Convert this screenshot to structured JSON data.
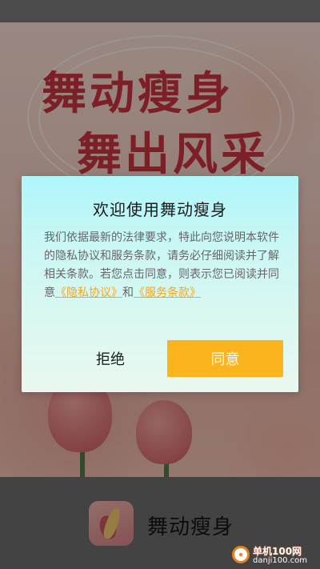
{
  "splash": {
    "slogan_line1": "舞动瘦身",
    "slogan_line2": "舞出风采"
  },
  "dialog": {
    "title": "欢迎使用舞动瘦身",
    "body_text": "我们依据最新的法律要求，特此向您说明本软件的隐私协议和服务条款，请务必仔细阅读并了解相关条款。若您点击同意，则表示您已阅读并同意",
    "privacy_link": "《隐私协议》",
    "conjunction": "和",
    "terms_link": "《服务条款》",
    "refuse_label": "拒绝",
    "agree_label": "同意"
  },
  "app": {
    "name": "舞动瘦身",
    "icon": "dancer-app-icon"
  },
  "watermark": {
    "name": "单机100网",
    "url": "danji100.com"
  },
  "colors": {
    "accent": "#fbb41e",
    "link": "#f3a81c",
    "slogan": "#c8323f",
    "dialog_top": "#aef6fb"
  }
}
